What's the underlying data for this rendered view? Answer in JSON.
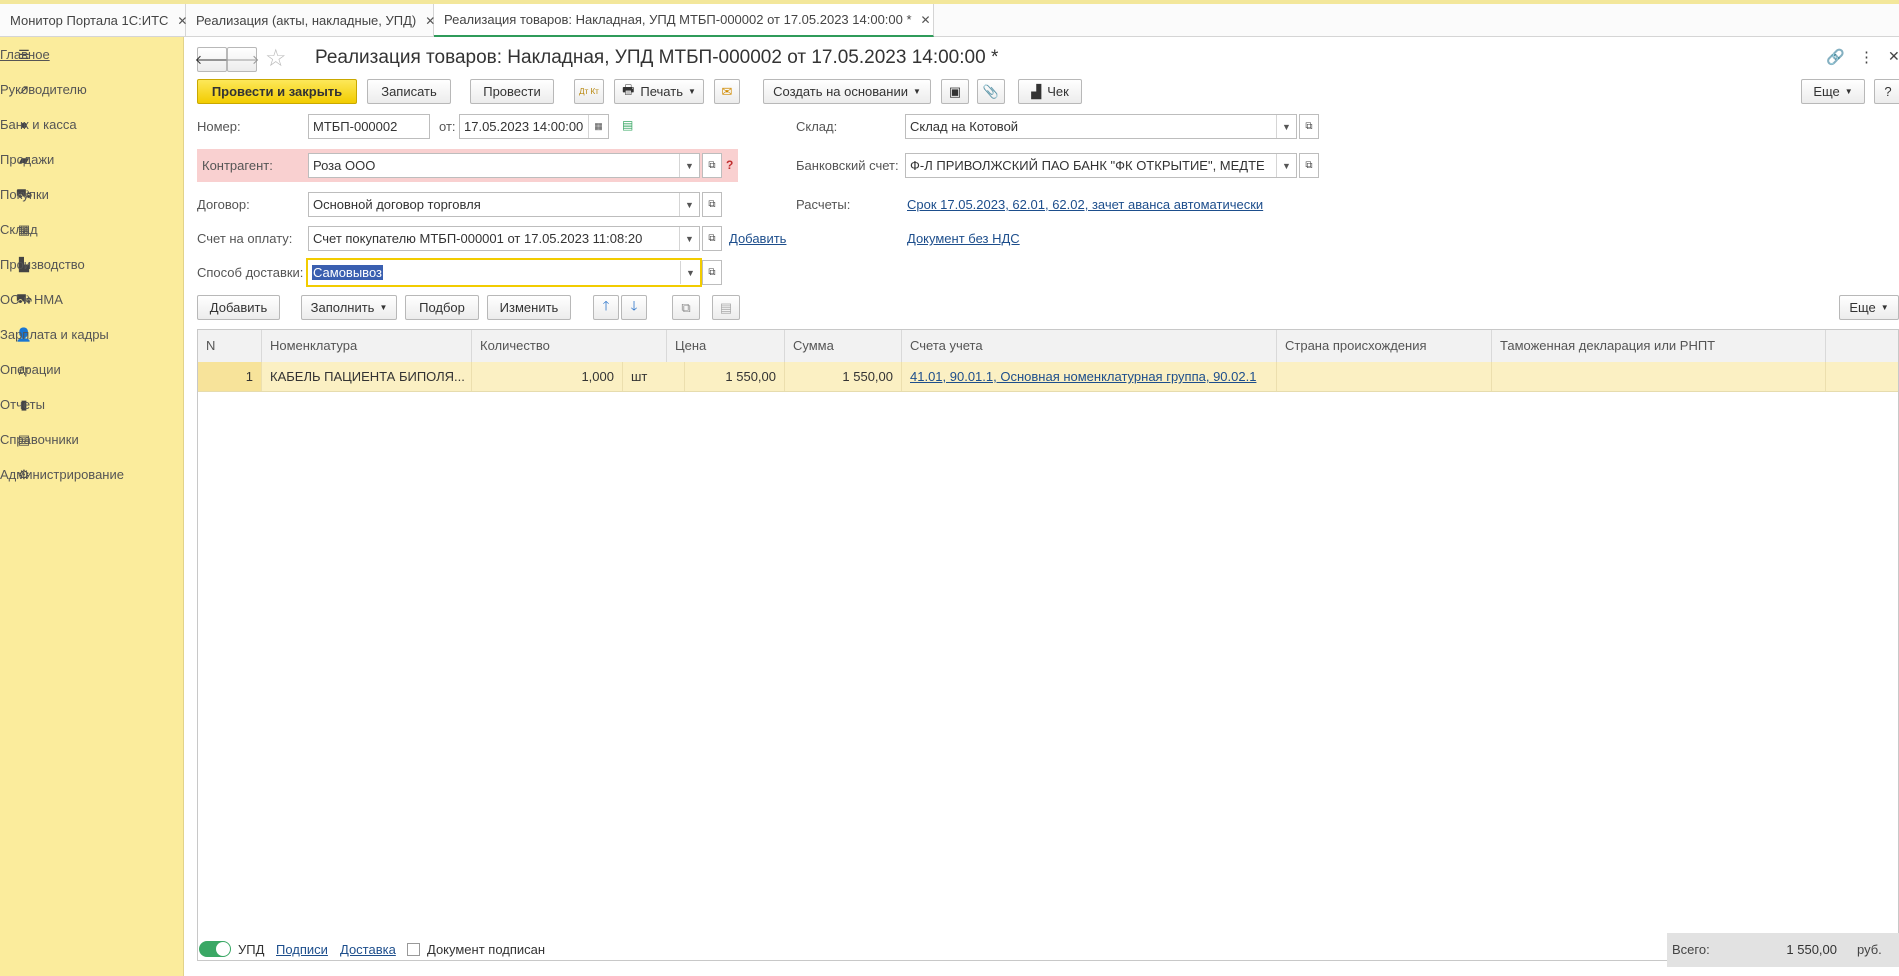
{
  "tabs": [
    {
      "label": "Монитор Портала 1С:ИТС"
    },
    {
      "label": "Реализация (акты, накладные, УПД)"
    },
    {
      "label": "Реализация товаров: Накладная, УПД МТБП-000002 от 17.05.2023 14:00:00 *"
    }
  ],
  "sidebar": {
    "items": [
      {
        "label": "Главное",
        "icon": "menu-icon"
      },
      {
        "label": "Руководителю",
        "icon": "trend-icon"
      },
      {
        "label": "Банк и касса",
        "icon": "coin-icon"
      },
      {
        "label": "Продажи",
        "icon": "bag-icon"
      },
      {
        "label": "Покупки",
        "icon": "cart-icon"
      },
      {
        "label": "Склад",
        "icon": "warehouse-icon"
      },
      {
        "label": "Производство",
        "icon": "factory-icon"
      },
      {
        "label": "ОС и НМА",
        "icon": "truck-icon"
      },
      {
        "label": "Зарплата и кадры",
        "icon": "person-icon"
      },
      {
        "label": "Операции",
        "icon": "dt-kt-icon"
      },
      {
        "label": "Отчеты",
        "icon": "report-icon"
      },
      {
        "label": "Справочники",
        "icon": "book-icon"
      },
      {
        "label": "Администрирование",
        "icon": "gear-icon"
      }
    ]
  },
  "header": {
    "title": "Реализация товаров: Накладная, УПД МТБП-000002 от 17.05.2023 14:00:00 *"
  },
  "toolbar": {
    "post_close": "Провести и закрыть",
    "save": "Записать",
    "post": "Провести",
    "dtkt": "Дт Кт",
    "print": "Печать",
    "create_based": "Создать на основании",
    "check": "Чек",
    "more": "Еще",
    "help": "?"
  },
  "fields": {
    "number_label": "Номер:",
    "number_value": "МТБП-000002",
    "from_label": "от:",
    "date_value": "17.05.2023 14:00:00",
    "warehouse_label": "Склад:",
    "warehouse_value": "Склад на Котовой",
    "counterparty_label": "Контрагент:",
    "counterparty_value": "Роза ООО",
    "question": "?",
    "bank_label": "Банковский счет:",
    "bank_value": "Ф-Л ПРИВОЛЖСКИЙ ПАО БАНК \"ФК ОТКРЫТИЕ\", МЕДТЕ",
    "contract_label": "Договор:",
    "contract_value": "Основной договор торговля",
    "settlements_label": "Расчеты:",
    "settlements_link": "Срок 17.05.2023, 62.01, 62.02, зачет аванса автоматически",
    "invoice_label": "Счет на оплату:",
    "invoice_value": "Счет покупателю МТБП-000001 от 17.05.2023 11:08:20",
    "invoice_add": "Добавить",
    "vat_link": "Документ без НДС",
    "delivery_label": "Способ доставки:",
    "delivery_value": "Самовывоз"
  },
  "table_toolbar": {
    "add": "Добавить",
    "fill": "Заполнить",
    "pick": "Подбор",
    "change": "Изменить",
    "more": "Еще"
  },
  "table": {
    "columns": [
      "N",
      "Номенклатура",
      "Количество",
      "Цена",
      "Сумма",
      "Счета учета",
      "Страна происхождения",
      "Таможенная декларация или РНПТ"
    ],
    "rows": [
      {
        "n": "1",
        "item": "КАБЕЛЬ ПАЦИЕНТА БИПОЛЯ...",
        "qty": "1,000",
        "unit": "шт",
        "price": "1 550,00",
        "sum": "1 550,00",
        "accounts": "41.01, 90.01.1, Основная номенклатурная группа, 90.02.1",
        "country": "",
        "customs": ""
      }
    ]
  },
  "footer": {
    "upd_label": "УПД",
    "signatures": "Подписи",
    "delivery": "Доставка",
    "signed_label": "Документ подписан",
    "total_label": "Всего:",
    "total_value": "1 550,00",
    "currency": "руб."
  },
  "colors": {
    "sidebar_bg": "#fbec9c",
    "primary_button": "#f2cc00",
    "link": "#1d4e8c",
    "error_bg": "#f9d0d0",
    "selected_row": "#fbf0c3",
    "toggle_on": "#3aa865"
  }
}
